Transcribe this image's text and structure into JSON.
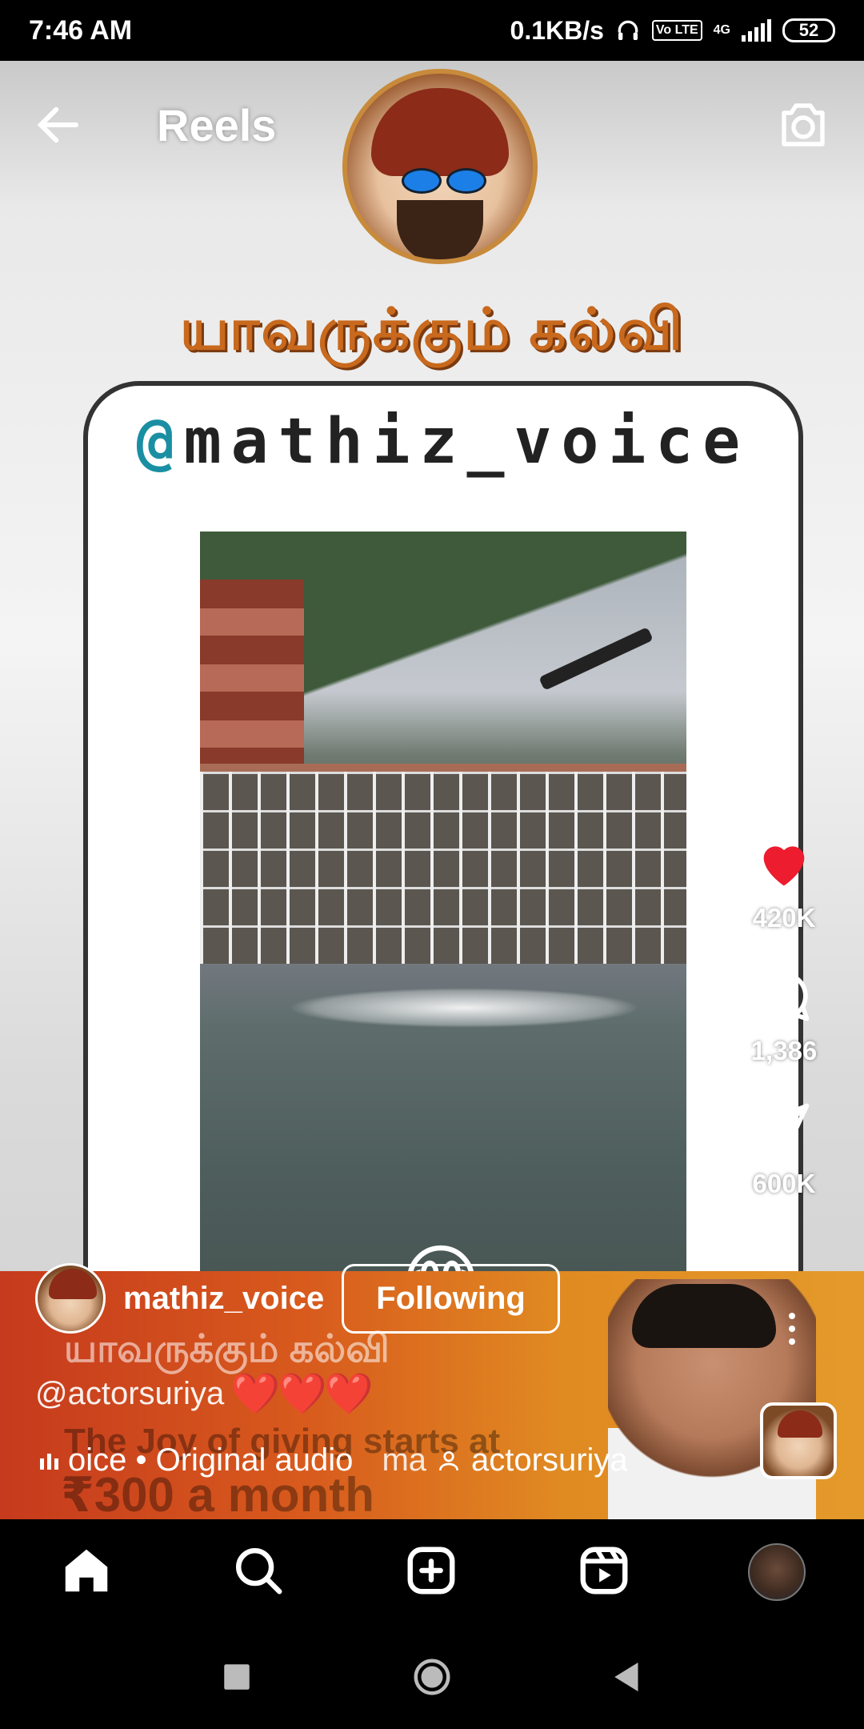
{
  "status_bar": {
    "time": "7:46 AM",
    "network_speed": "0.1KB/s",
    "volte": "Vo LTE",
    "network_type": "4G",
    "battery": "52"
  },
  "header": {
    "title": "Reels",
    "back_icon": "arrow-left-icon",
    "camera_icon": "camera-icon"
  },
  "video": {
    "overlay_title": "யாவருக்கும் கல்வி",
    "handle_at": "@",
    "handle_text": "mathiz_voice",
    "emoji": "😂"
  },
  "actions": {
    "likes": "420K",
    "comments": "1,386",
    "shares": "600K",
    "like_color": "#ed1c2e"
  },
  "ad": {
    "tamil": "யாவருக்கும் கல்வி",
    "joy": "The Joy of giving starts at",
    "price": "₹300 a month"
  },
  "post": {
    "username": "mathiz_voice",
    "follow_label": "Following",
    "caption": "@actorsuriya",
    "caption_emoji": "❤️❤️❤️",
    "audio": "oice • Original audio",
    "audio_tail": "ma",
    "tagged": "actorsuriya"
  },
  "nav": [
    "home-icon",
    "search-icon",
    "create-icon",
    "reels-icon",
    "profile-avatar"
  ],
  "system_nav": [
    "recent-apps-icon",
    "home-circle-icon",
    "back-triangle-icon"
  ]
}
